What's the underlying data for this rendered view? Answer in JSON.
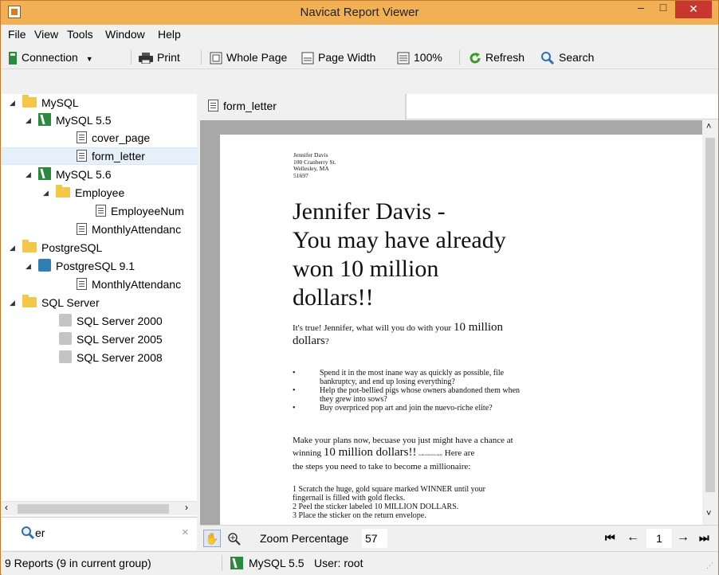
{
  "window": {
    "title": "Navicat Report Viewer",
    "close_glyph": "✕",
    "min_glyph": "–",
    "max_glyph": "□"
  },
  "menu": [
    "File",
    "View",
    "Tools",
    "Window",
    "Help"
  ],
  "toolbar": {
    "connection": "Connection",
    "print": "Print",
    "whole_page": "Whole Page",
    "page_width": "Page Width",
    "zoom100": "100%",
    "refresh": "Refresh",
    "search": "Search"
  },
  "tree": {
    "mysql": "MySQL",
    "mysql55": "MySQL 5.5",
    "cover_page": "cover_page",
    "form_letter": "form_letter",
    "mysql56": "MySQL 5.6",
    "employee": "Employee",
    "employeenum": "EmployeeNum",
    "monthly1": "MonthlyAttendanc",
    "postgresql": "PostgreSQL",
    "pg91": "PostgreSQL 9.1",
    "monthly2": "MonthlyAttendanc",
    "sqlserver": "SQL Server",
    "ss2000": "SQL Server 2000",
    "ss2005": "SQL Server 2005",
    "ss2008": "SQL Server 2008"
  },
  "search": {
    "value": "er",
    "clear": "×"
  },
  "tab": {
    "label": "form_letter"
  },
  "letter": {
    "addr1": "Jennifer Davis",
    "addr2": "100 Cranberry St.",
    "addr3": "Wellesley, MA",
    "addr4": "51697",
    "headline1": "Jennifer Davis -",
    "headline2": "You may have already",
    "headline3": "won 10 million",
    "headline4": "dollars!!",
    "p1a": "It's true!  Jennifer, what will you do with your ",
    "p1big": "10 million",
    "p1c": "dollars",
    "p1d": "?",
    "bullet1a": "Spend it in the most inane way as quickly as possible, file",
    "bullet1b": "bankruptcy, and end up losing everything?",
    "bullet2a": "Help the pot-bellied pigs whose owners abandoned them when",
    "bullet2b": "they grew into sows?",
    "bullet3": "Buy overpriced pop art and join the nuevo-riche elite?",
    "p2a": "Make your plans now, becuase you just might have a chance at",
    "p2b": "winning ",
    "p2big": "10 million dollars!!",
    "p2fine": "(some restrictions apply)",
    "p2c": " Here are",
    "p2d": "the steps you need to take to become a millionaire:",
    "step1a": "1  Scratch the huge, gold square marked WINNER until your",
    "step1b": "fingernail is filled with gold flecks.",
    "step2": "2  Peel the sticker labeled 10 MILLION DOLLARS.",
    "step3": "3  Place the sticker on the return envelope."
  },
  "zoom": {
    "label": "Zoom Percentage",
    "value": "57"
  },
  "nav": {
    "page": "1"
  },
  "status": {
    "reports": "9 Reports (9 in current group)",
    "connection": "MySQL 5.5",
    "user": "User: root"
  },
  "colors": {
    "titlebar": "#f1b054",
    "close": "#c7372f",
    "folder": "#f4c748",
    "mysql": "#2a8a3e",
    "refresh": "#3a9a2a",
    "selection": "#e5f0fb"
  }
}
